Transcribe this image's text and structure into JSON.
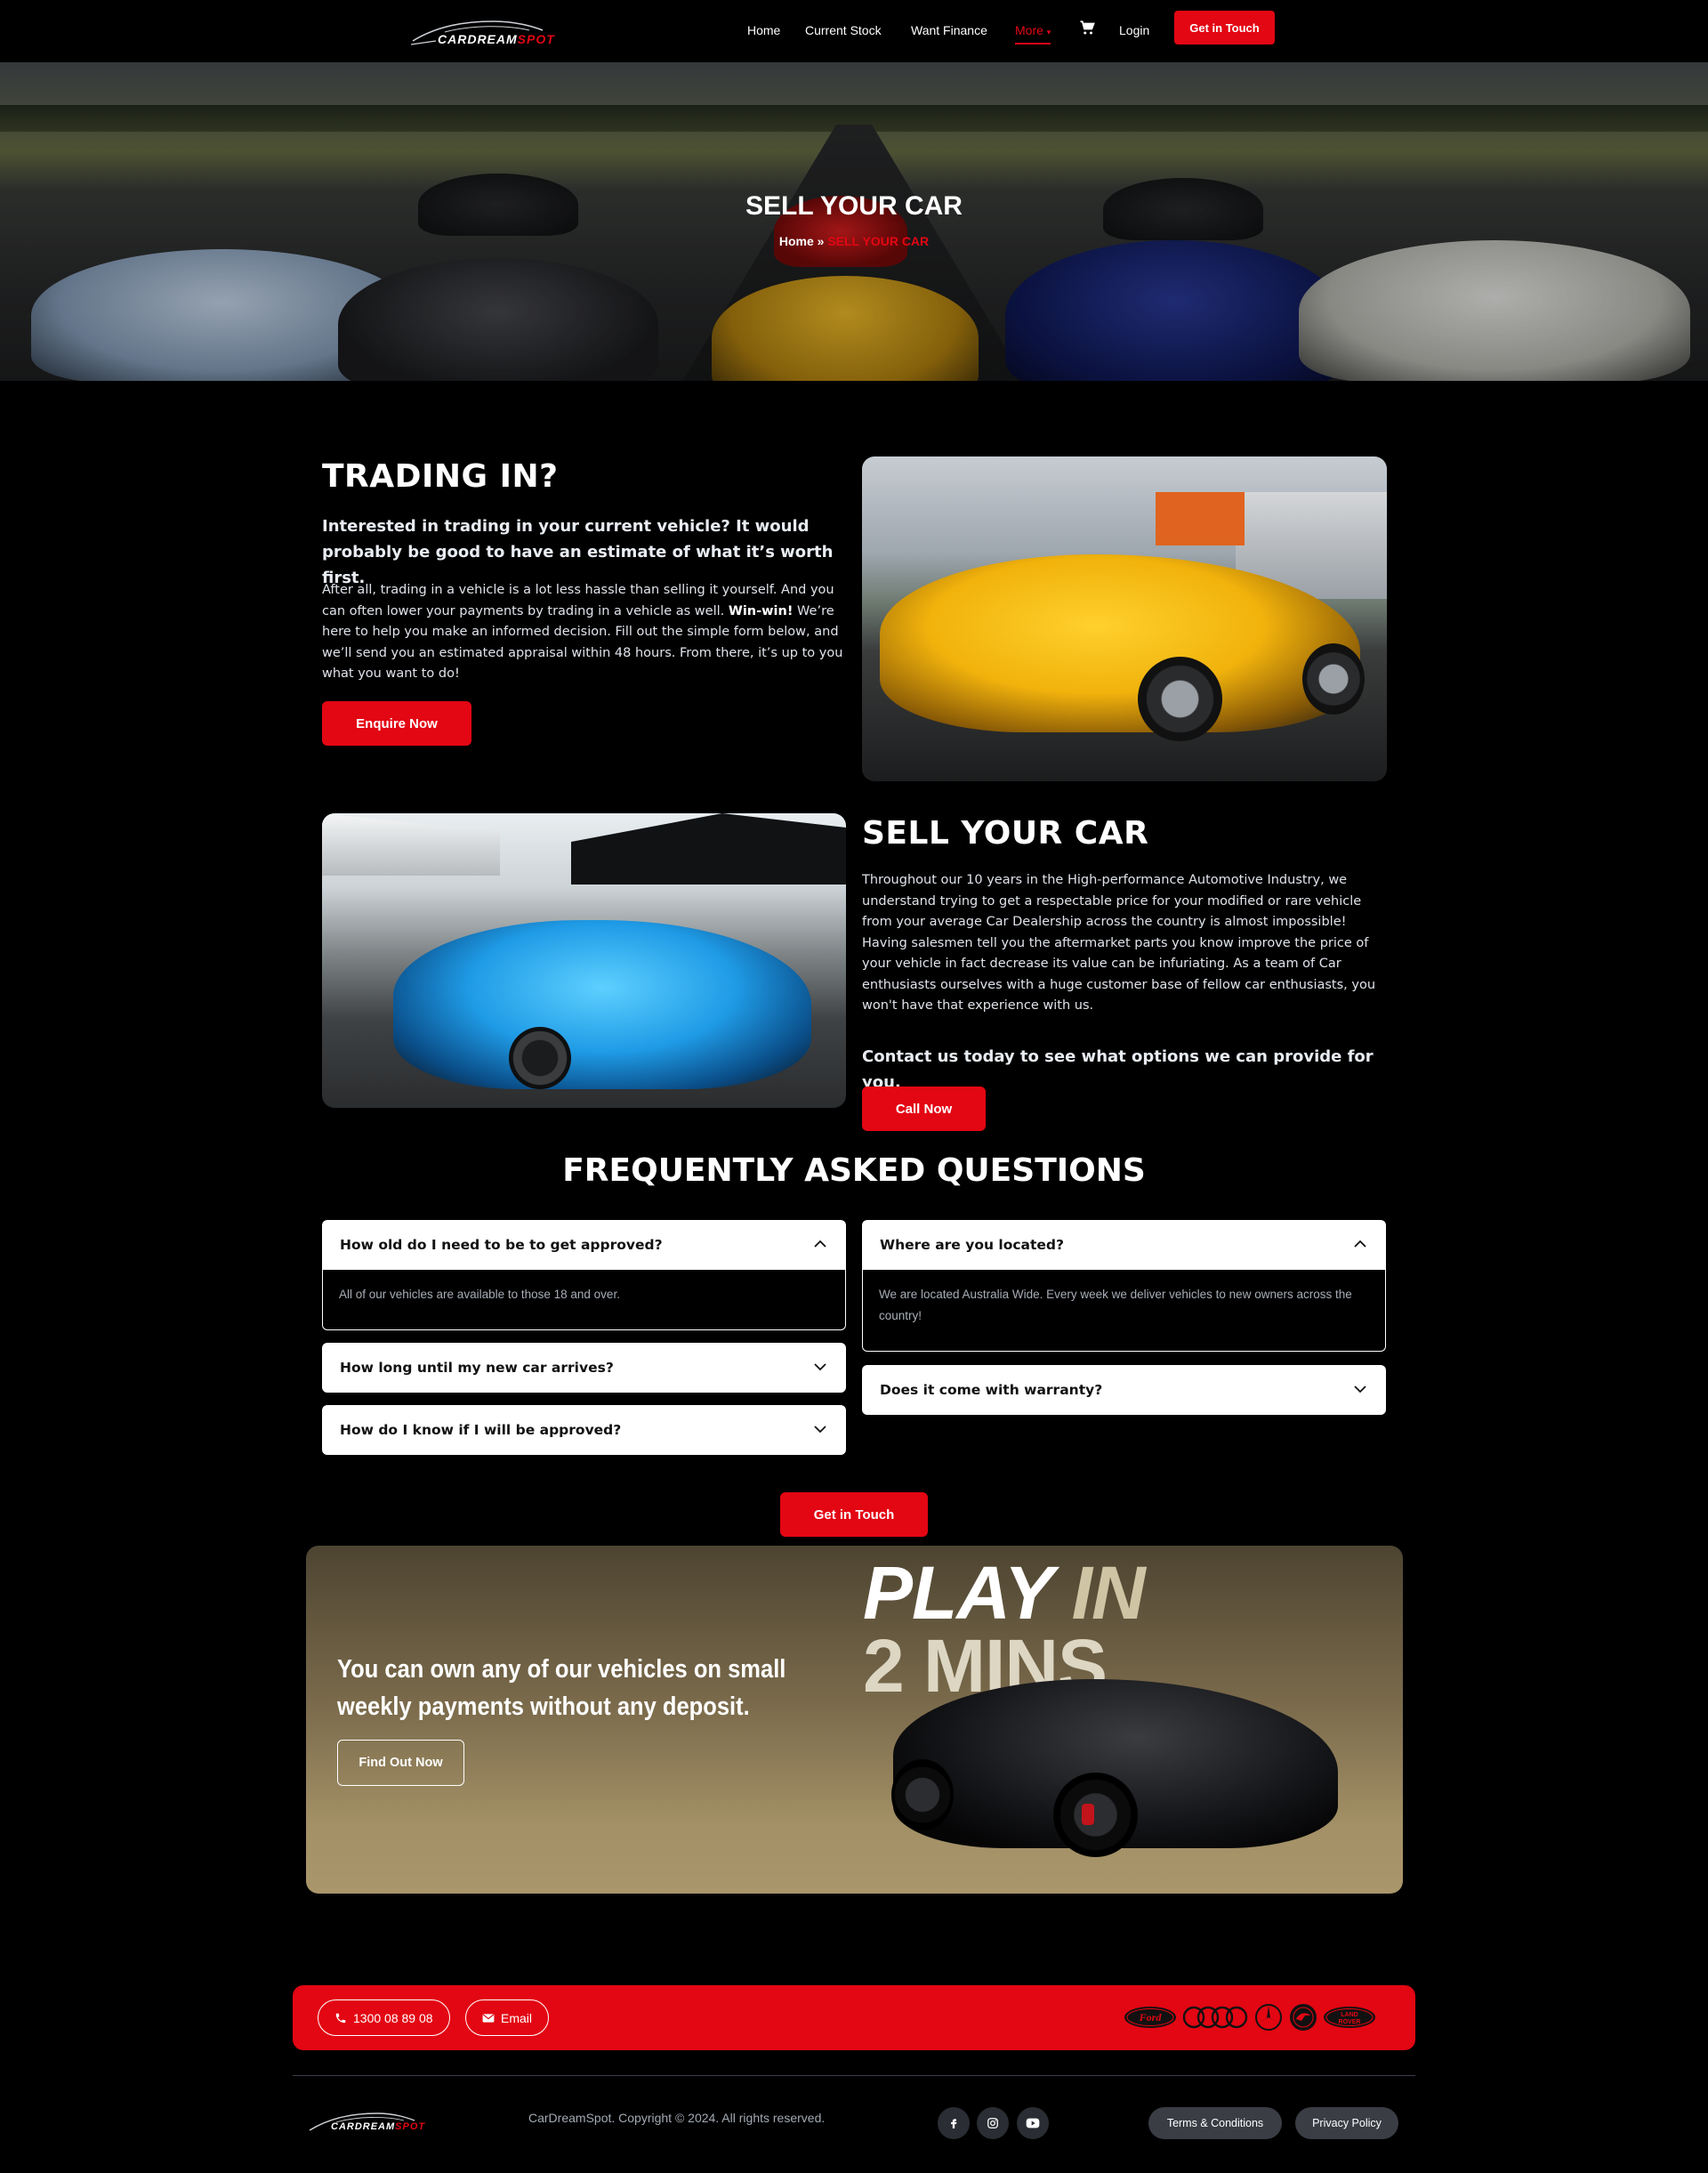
{
  "header": {
    "logo": {
      "text_a": "CARDREAM",
      "text_b": "SPOT"
    },
    "nav": [
      "Home",
      "Current Stock",
      "Want Finance",
      "More",
      "Login"
    ],
    "cta": "Get in Touch"
  },
  "hero": {
    "title": "SELL YOUR CAR",
    "breadcrumb_home": "Home",
    "breadcrumb_sep": " » ",
    "breadcrumb_current": "SELL YOUR CAR"
  },
  "trading": {
    "heading": "TRADING IN?",
    "lead": "Interested in trading in your current vehicle? It would probably be good to have an estimate of what it’s worth first.",
    "body_a": "After all, trading in a vehicle is a lot less hassle than selling it yourself. And you can often lower your payments by trading in a vehicle as well. ",
    "body_bold": "Win-win!",
    "body_b": " We’re here to help you make an informed decision. Fill out the simple form below, and we’ll send you an estimated appraisal within 48 hours. From there, it’s up to you what you want to do!",
    "button": "Enquire Now"
  },
  "sell": {
    "heading": "SELL YOUR CAR",
    "body": "Throughout our 10 years in the High-performance Automotive Industry, we understand trying to get a respectable price for your modified or rare vehicle from your average Car Dealership across the country is almost impossible! Having salesmen tell you the aftermarket parts you know improve the price of your vehicle in fact decrease its value can be infuriating. As a team of Car enthusiasts ourselves with a huge customer base of fellow car enthusiasts, you won't have that experience with us.",
    "lead": "Contact us today to see what options we can provide for you.",
    "button": "Call Now"
  },
  "faq": {
    "title": "FREQUENTLY ASKED QUESTIONS",
    "left": [
      {
        "q": "How old do I need to be to get approved?",
        "a": "All of our vehicles are available to those 18 and over."
      },
      {
        "q": "How long until my new car arrives?"
      },
      {
        "q": "How do I know if I will be approved?"
      }
    ],
    "right": [
      {
        "q": "Where are you located?",
        "a": "We are located Australia Wide. Every week we deliver vehicles to new owners across the country!"
      },
      {
        "q": "Does it come with warranty?"
      }
    ],
    "cta": "Get in Touch"
  },
  "banner": {
    "text": "You can own any of our vehicles on small weekly payments without any deposit.",
    "button": "Find Out Now",
    "play_a": "PLAY ",
    "play_b": "IN",
    "play_c": "2 MINS"
  },
  "contact_bar": {
    "phone": "1300 08 89 08",
    "email": "Email",
    "brands": [
      "Ford",
      "Audi",
      "Mercedes-Benz",
      "Skoda",
      "Land Rover"
    ],
    "brand_ford_text": "Ford",
    "brand_lr_text_a": "LAND",
    "brand_lr_text_b": "ROVER"
  },
  "footer": {
    "logo": {
      "text_a": "CARDREAM",
      "text_b": "SPOT"
    },
    "copyright": "CarDreamSpot. Copyright © 2024. All rights reserved.",
    "social_icons": [
      "facebook-icon",
      "instagram-icon",
      "youtube-icon"
    ],
    "terms": "Terms & Conditions",
    "privacy": "Privacy Policy"
  },
  "colors": {
    "accent": "#e30613",
    "background": "#000000",
    "banner_gold": "#a39066"
  }
}
